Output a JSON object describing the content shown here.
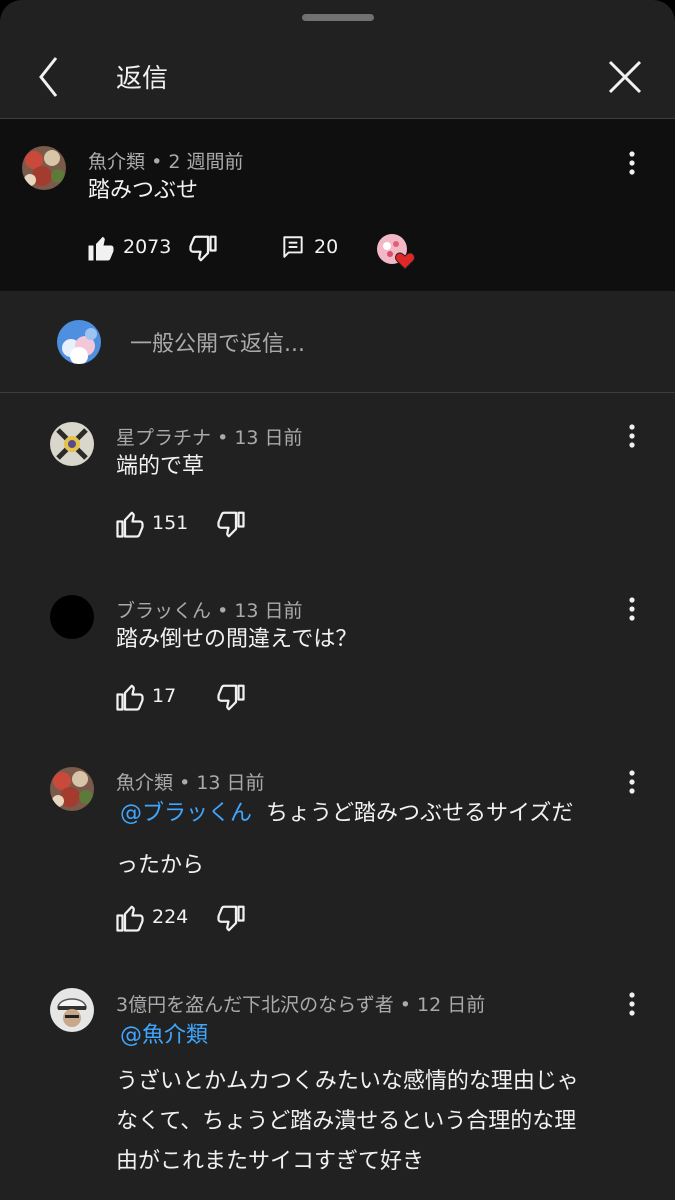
{
  "header": {
    "title": "返信"
  },
  "parent_comment": {
    "author": "魚介類",
    "time": "2 週間前",
    "text": "踏みつぶせ",
    "likes": "2073",
    "replies": "20"
  },
  "reply_input": {
    "placeholder": "一般公開で返信..."
  },
  "replies": [
    {
      "author": "星プラチナ",
      "time": "13 日前",
      "text": "端的で草",
      "likes": "151"
    },
    {
      "author": "ブラッくん",
      "time": "13 日前",
      "text": "踏み倒せの間違えでは？",
      "likes": "17"
    },
    {
      "author": "魚介類",
      "time": "13 日前",
      "mention": "@ブラッくん",
      "text_line1": "ちょうど踏みつぶせるサイズだ",
      "text_line2": "ったから",
      "likes": "224"
    },
    {
      "author": "3億円を盗んだ下北沢のならず者",
      "time": "12 日前",
      "mention": "@魚介類",
      "text_line1": "うざいとかムカつくみたいな感情的な理由じゃ",
      "text_line2": "なくて、ちょうど踏み潰せるという合理的な理",
      "text_line3": "由がこれまたサイコすぎて好き"
    }
  ],
  "separator": "•"
}
